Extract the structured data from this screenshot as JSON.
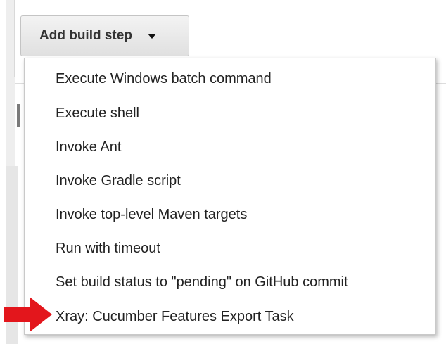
{
  "add_build_step": {
    "label": "Add build step",
    "icon": "chevron-down-icon"
  },
  "menu": {
    "items": [
      {
        "label": "Execute Windows batch command"
      },
      {
        "label": "Execute shell"
      },
      {
        "label": "Invoke Ant"
      },
      {
        "label": "Invoke Gradle script"
      },
      {
        "label": "Invoke top-level Maven targets"
      },
      {
        "label": "Run with timeout"
      },
      {
        "label": "Set build status to \"pending\" on GitHub commit"
      },
      {
        "label": "Xray: Cucumber Features Export Task"
      }
    ]
  },
  "annotation": {
    "icon": "red-arrow-icon",
    "color": "#e3161c"
  },
  "colors": {
    "button_bg": "#e8e8e8",
    "menu_border": "#c9c9c9",
    "text": "#222222"
  }
}
